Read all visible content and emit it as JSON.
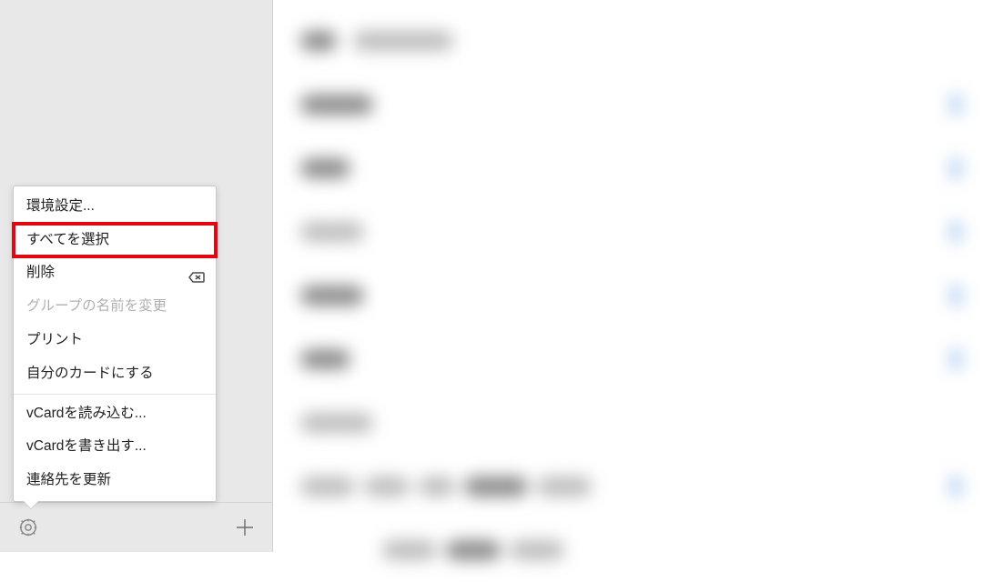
{
  "menu": {
    "preferences": "環境設定...",
    "select_all": "すべてを選択",
    "delete": "削除",
    "rename_group": "グループの名前を変更",
    "print": "プリント",
    "make_my_card": "自分のカードにする",
    "import_vcard": "vCardを読み込む...",
    "export_vcard": "vCardを書き出す...",
    "refresh_contacts": "連絡先を更新"
  }
}
